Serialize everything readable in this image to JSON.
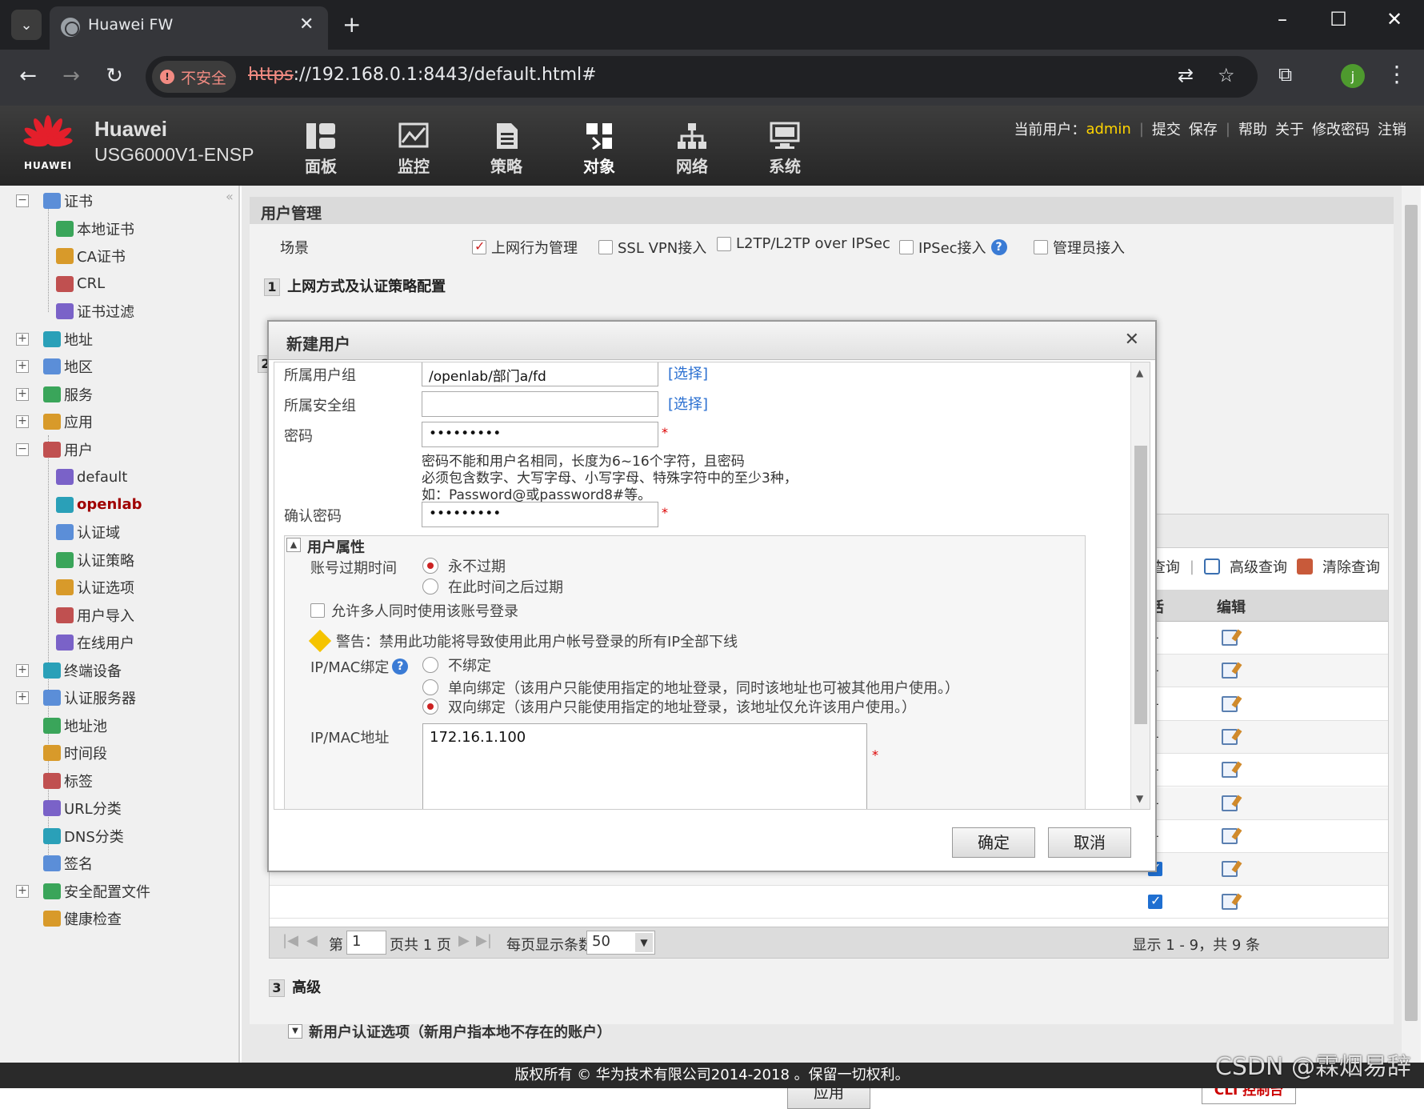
{
  "browser": {
    "tab_title": "Huawei FW",
    "insecure_label": "不安全",
    "url_scheme": "https",
    "url_rest": "://192.168.0.1:8443/default.html#",
    "profile_initial": "j"
  },
  "header": {
    "logo_text": "HUAWEI",
    "brand_line1": "Huawei",
    "brand_line2": "USG6000V1-ENSP",
    "nav": [
      {
        "label": "面板",
        "icon": "dashboard-icon"
      },
      {
        "label": "监控",
        "icon": "monitor-icon"
      },
      {
        "label": "策略",
        "icon": "policy-icon"
      },
      {
        "label": "对象",
        "icon": "object-icon"
      },
      {
        "label": "网络",
        "icon": "network-icon"
      },
      {
        "label": "系统",
        "icon": "system-icon"
      }
    ],
    "active_nav": "对象",
    "current_user_label": "当前用户：",
    "current_user": "admin",
    "links": [
      "提交",
      "保存",
      "帮助",
      "关于",
      "修改密码",
      "注销"
    ]
  },
  "sidebar": {
    "items": [
      {
        "label": "证书",
        "level": 0,
        "exp": "−"
      },
      {
        "label": "本地证书",
        "level": 1
      },
      {
        "label": "CA证书",
        "level": 1
      },
      {
        "label": "CRL",
        "level": 1
      },
      {
        "label": "证书过滤",
        "level": 1
      },
      {
        "label": "地址",
        "level": 0,
        "exp": "+"
      },
      {
        "label": "地区",
        "level": 0,
        "exp": "+"
      },
      {
        "label": "服务",
        "level": 0,
        "exp": "+"
      },
      {
        "label": "应用",
        "level": 0,
        "exp": "+"
      },
      {
        "label": "用户",
        "level": 0,
        "exp": "−"
      },
      {
        "label": "default",
        "level": 1
      },
      {
        "label": "openlab",
        "level": 1,
        "selected": true
      },
      {
        "label": "认证域",
        "level": 1
      },
      {
        "label": "认证策略",
        "level": 1
      },
      {
        "label": "认证选项",
        "level": 1
      },
      {
        "label": "用户导入",
        "level": 1
      },
      {
        "label": "在线用户",
        "level": 1
      },
      {
        "label": "终端设备",
        "level": 0,
        "exp": "+"
      },
      {
        "label": "认证服务器",
        "level": 0,
        "exp": "+"
      },
      {
        "label": "地址池",
        "level": 0
      },
      {
        "label": "时间段",
        "level": 0
      },
      {
        "label": "标签",
        "level": 0
      },
      {
        "label": "URL分类",
        "level": 0
      },
      {
        "label": "DNS分类",
        "level": 0
      },
      {
        "label": "签名",
        "level": 0
      },
      {
        "label": "安全配置文件",
        "level": 0,
        "exp": "+"
      },
      {
        "label": "健康检查",
        "level": 0
      }
    ]
  },
  "main": {
    "section_title": "用户管理",
    "scene_label": "场景",
    "scene_options": [
      {
        "label": "上网行为管理",
        "checked": true
      },
      {
        "label": "SSL VPN接入",
        "checked": false
      },
      {
        "label": "L2TP/L2TP over IPSec",
        "checked": false
      },
      {
        "label": "IPSec接入",
        "checked": false,
        "help": true
      },
      {
        "label": "管理员接入",
        "checked": false
      }
    ],
    "step1_num": "1",
    "step1_title": "上网方式及认证策略配置",
    "step2_num": "2",
    "grid": {
      "actions": [
        "查询",
        "高级查询",
        "清除查询"
      ],
      "col_active": "激活",
      "col_edit": "编辑",
      "rows": [
        {
          "active": "--"
        },
        {
          "active": "--"
        },
        {
          "active": "--"
        },
        {
          "active": "--"
        },
        {
          "active": "--"
        },
        {
          "active": "--"
        },
        {
          "active": "--"
        },
        {
          "active": "checked"
        },
        {
          "active": "checked"
        }
      ]
    },
    "pager": {
      "page_prefix": "第",
      "page_value": "1",
      "page_suffix": "页共 1 页",
      "per_page_label": "每页显示条数",
      "per_page_value": "50",
      "info": "显示 1 - 9，共 9 条"
    },
    "step3_num": "3",
    "step3_title": "高级",
    "newuser_option": "新用户认证选项（新用户指本地不存在的账户）",
    "apply_label": "应用",
    "cli_label": "CLI 控制台"
  },
  "modal": {
    "title": "新建用户",
    "group_label": "所属用户组",
    "group_value": "/openlab/部门a/fd",
    "select_link": "[选择]",
    "secgroup_label": "所属安全组",
    "secgroup_value": "",
    "password_label": "密码",
    "password_value": "•••••••••",
    "password_hint1": "密码不能和用户名相同，长度为6~16个字符，且密码",
    "password_hint2": "必须包含数字、大写字母、小写字母、特殊字符中的至少3种，",
    "password_hint3": "如：Password@或password8#等。",
    "confirm_label": "确认密码",
    "confirm_value": "•••••••••",
    "attr_title": "用户属性",
    "expire_label": "账号过期时间",
    "expire_never": "永不过期",
    "expire_after": "在此时间之后过期",
    "multi_login": "允许多人同时使用该账号登录",
    "warning": "警告：禁用此功能将导致使用此用户帐号登录的所有IP全部下线",
    "ipmac_bind_label": "IP/MAC绑定",
    "bind_none": "不绑定",
    "bind_one": "单向绑定（该用户只能使用指定的地址登录，同时该地址也可被其他用户使用。）",
    "bind_two": "双向绑定（该用户只能使用指定的地址登录，该地址仅允许该用户使用。）",
    "ipmac_addr_label": "IP/MAC地址",
    "ipmac_addr_value": "172.16.1.100",
    "ok_label": "确定",
    "cancel_label": "取消"
  },
  "footer": {
    "copyright": "版权所有 © 华为技术有限公司2014-2018 。保留一切权利。",
    "watermark": "CSDN @霖烟易辞"
  }
}
